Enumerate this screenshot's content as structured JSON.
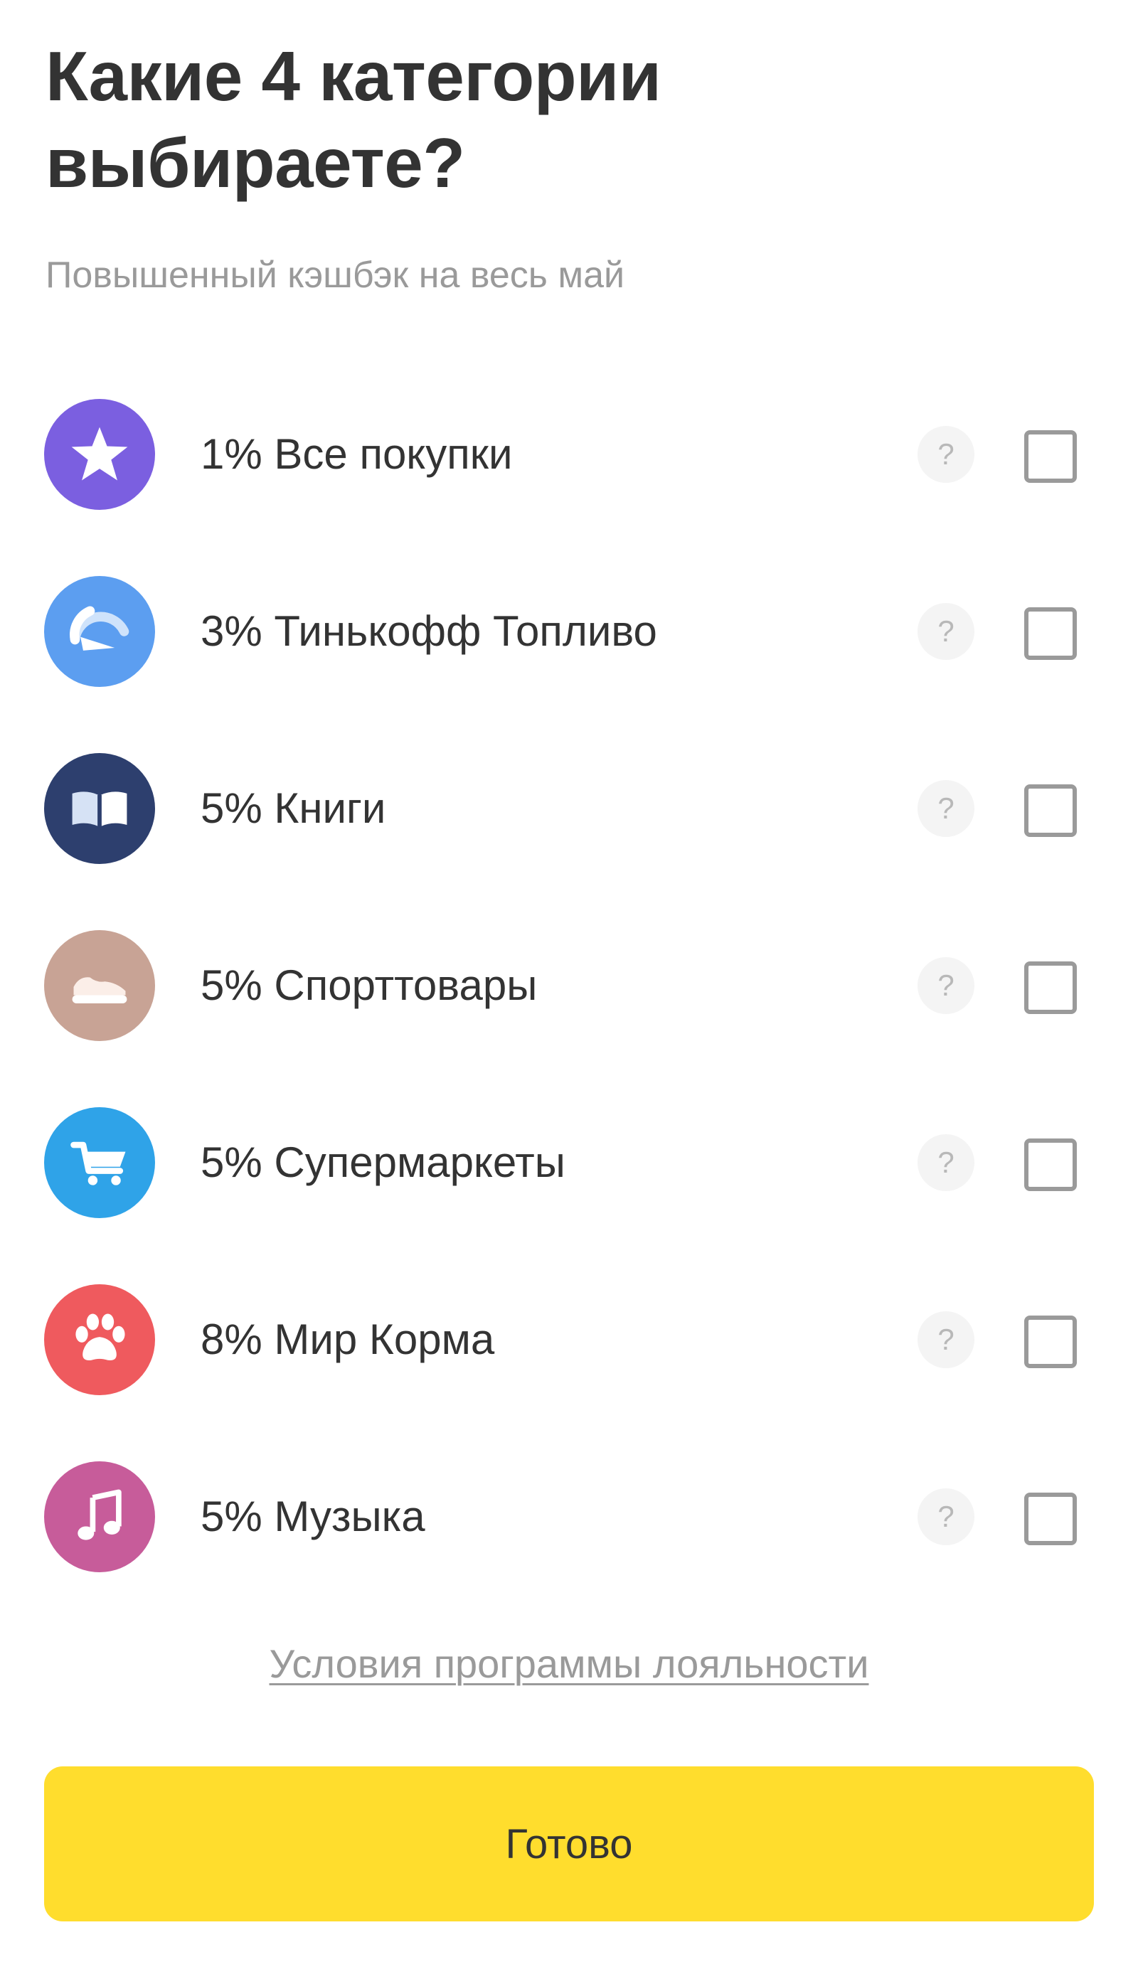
{
  "header": {
    "title": "Какие 4 категории выбираете?",
    "subtitle": "Повышенный кэшбэк на весь май"
  },
  "categories": [
    {
      "label": "1% Все покупки",
      "icon": "star-icon",
      "color": "#7b5fe0",
      "help": "?",
      "checked": false
    },
    {
      "label": "3% Тинькофф Топливо",
      "icon": "fuel-gauge-icon",
      "color": "#5c9ef0",
      "help": "?",
      "checked": false
    },
    {
      "label": "5% Книги",
      "icon": "book-icon",
      "color": "#2d3f6e",
      "help": "?",
      "checked": false
    },
    {
      "label": "5% Спорттовары",
      "icon": "sneaker-icon",
      "color": "#c8a395",
      "help": "?",
      "checked": false
    },
    {
      "label": "5% Супермаркеты",
      "icon": "cart-icon",
      "color": "#2fa3e8",
      "help": "?",
      "checked": false
    },
    {
      "label": "8% Мир Корма",
      "icon": "paw-icon",
      "color": "#ef5a5e",
      "help": "?",
      "checked": false
    },
    {
      "label": "5% Музыка",
      "icon": "music-note-icon",
      "color": "#c75c9a",
      "help": "?",
      "checked": false
    }
  ],
  "footer": {
    "loyalty_link": "Условия программы лояльности",
    "done_label": "Готово",
    "done_color": "#ffdd2d"
  }
}
